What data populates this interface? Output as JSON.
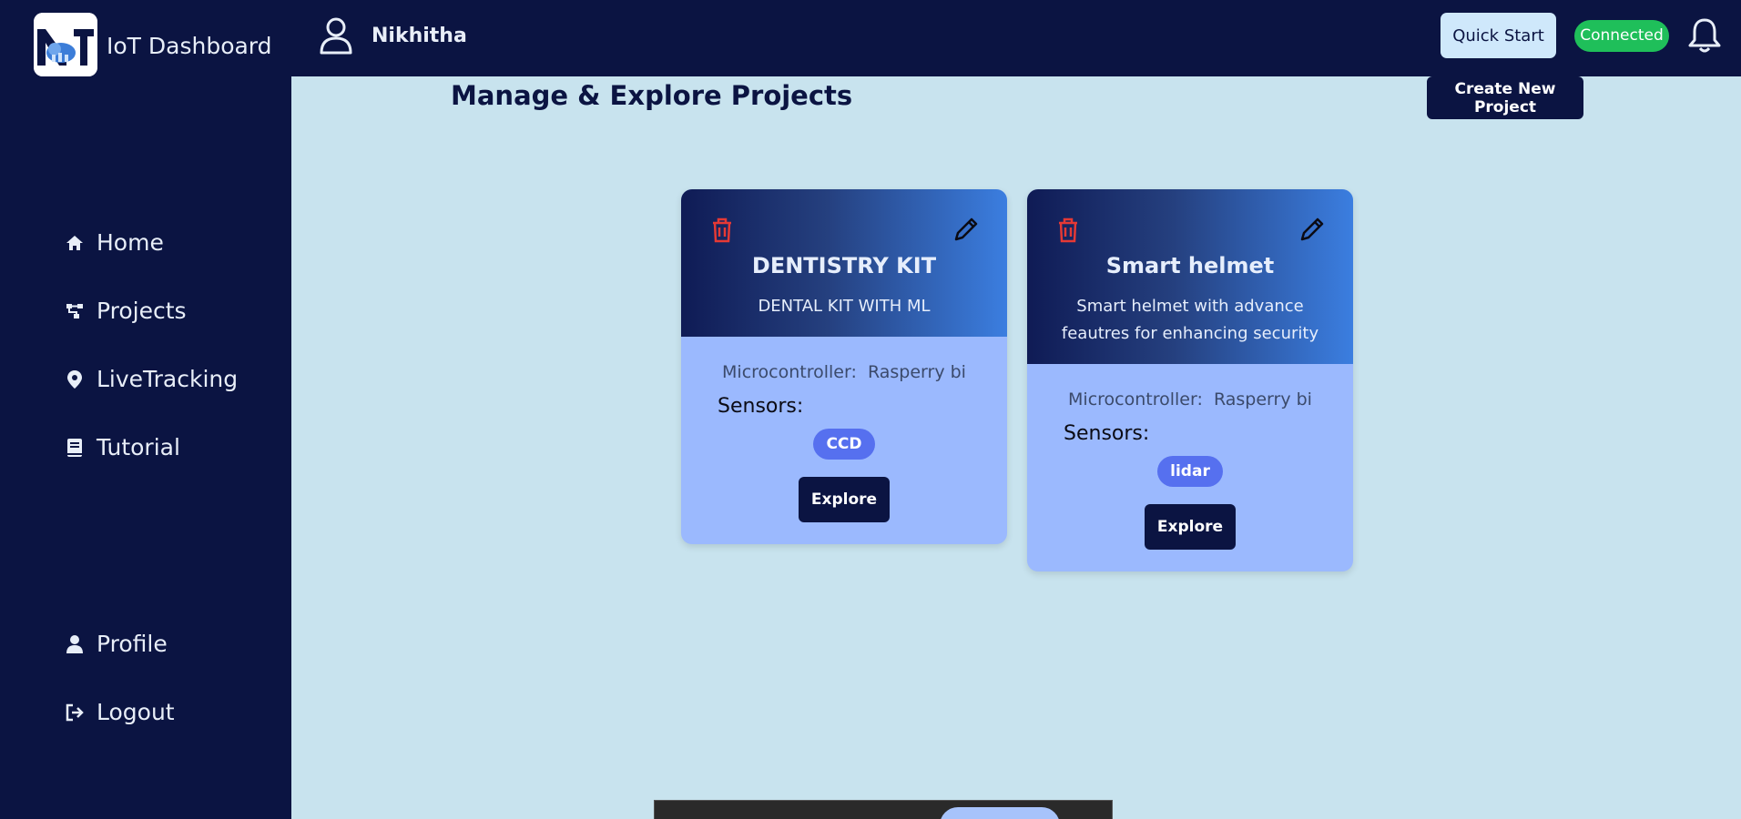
{
  "header": {
    "app_title": "IoT Dashboard",
    "user_name": "Nikhitha",
    "quick_start_label": "Quick Start",
    "status_label": "Connected",
    "icons": [
      "logo-icon",
      "user-icon",
      "bell-icon"
    ]
  },
  "sidebar": {
    "items": [
      {
        "label": "Home",
        "icon": "home-icon"
      },
      {
        "label": "Projects",
        "icon": "projects-icon"
      },
      {
        "label": "LiveTracking",
        "icon": "location-pin-icon"
      },
      {
        "label": "Tutorial",
        "icon": "book-icon"
      },
      {
        "label": "Profile",
        "icon": "person-icon"
      },
      {
        "label": "Logout",
        "icon": "logout-icon"
      }
    ]
  },
  "main": {
    "title": "Manage & Explore Projects",
    "create_label": "Create New Project",
    "projects": [
      {
        "title": "DENTISTRY KIT",
        "description": "DENTAL KIT WITH ML",
        "microcontroller_label": "Microcontroller:",
        "microcontroller": "Rasperry bi",
        "sensors_label": "Sensors:",
        "sensors": [
          "CCD"
        ],
        "explore_label": "Explore"
      },
      {
        "title": "Smart helmet",
        "description": "Smart helmet with advance feautres for enhancing security",
        "microcontroller_label": "Microcontroller:",
        "microcontroller": "Rasperry bi",
        "sensors_label": "Sensors:",
        "sensors": [
          "lidar"
        ],
        "explore_label": "Explore"
      }
    ]
  },
  "colors": {
    "navy": "#0b1442",
    "background": "#c8e3ee",
    "card_body": "#9bb9fe",
    "chip": "#5670ef",
    "connected": "#1fbf5a",
    "delete_icon": "#e53935"
  }
}
